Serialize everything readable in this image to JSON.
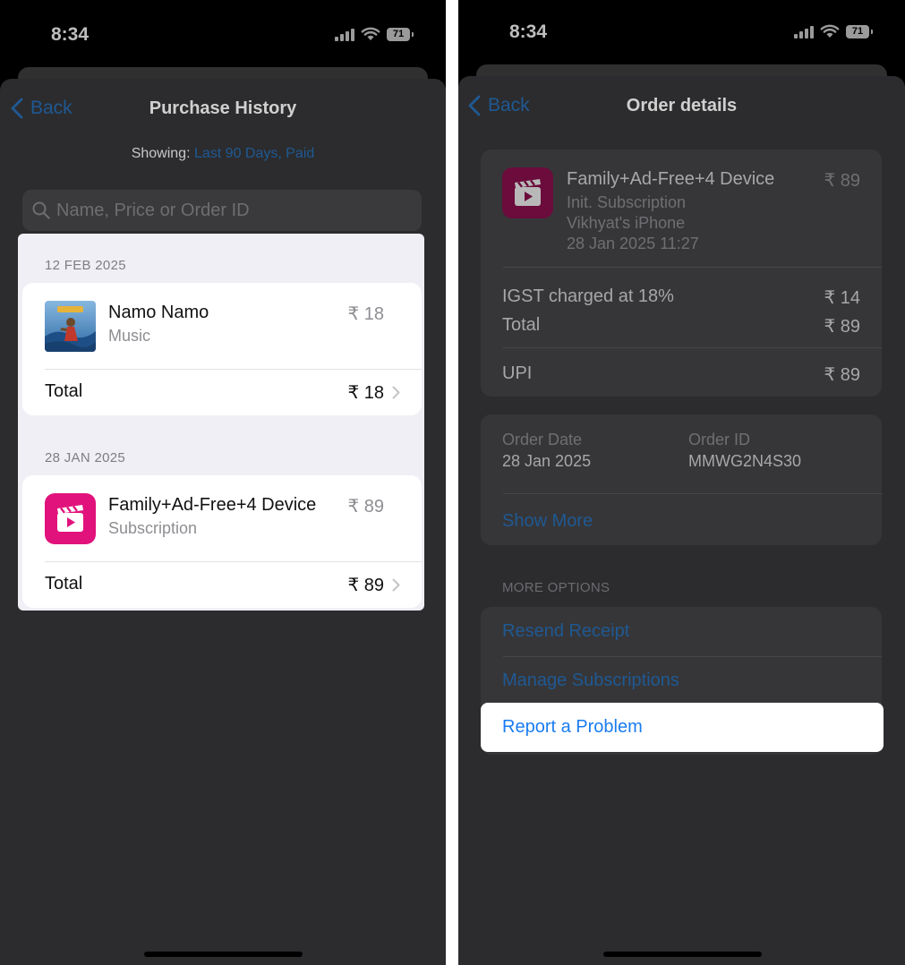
{
  "left_phone": {
    "status": {
      "time": "8:34",
      "battery": "71"
    },
    "nav": {
      "back_label": "Back",
      "title": "Purchase History"
    },
    "filter": {
      "label": "Showing:",
      "value": "Last 90 Days, Paid"
    },
    "search": {
      "placeholder": "Name, Price or Order ID"
    },
    "groups": [
      {
        "date": "12 FEB 2025",
        "item": {
          "title": "Namo Namo",
          "subtitle": "Music",
          "price": "₹ 18"
        },
        "total": {
          "label": "Total",
          "price": "₹ 18"
        }
      },
      {
        "date": "28 JAN 2025",
        "item": {
          "title": "Family+Ad-Free+4 Device",
          "subtitle": "Subscription",
          "price": "₹ 89"
        },
        "total": {
          "label": "Total",
          "price": "₹ 89"
        }
      }
    ]
  },
  "right_phone": {
    "status": {
      "time": "8:34",
      "battery": "71"
    },
    "nav": {
      "back_label": "Back",
      "title": "Order details"
    },
    "order_item": {
      "title": "Family+Ad-Free+4 Device",
      "price": "₹ 89",
      "lines": [
        "Init. Subscription",
        "Vikhyat's iPhone",
        "28 Jan 2025 11:27"
      ]
    },
    "charges": [
      {
        "label": "IGST charged at 18%",
        "value": "₹ 14"
      },
      {
        "label": "Total",
        "value": "₹ 89"
      }
    ],
    "payment": {
      "label": "UPI",
      "value": "₹ 89"
    },
    "order_info": {
      "date_label": "Order Date",
      "date_value": "28 Jan 2025",
      "id_label": "Order ID",
      "id_value": "MMWG2N4S30",
      "show_more": "Show More"
    },
    "more_options": {
      "header": "MORE OPTIONS",
      "resend_receipt": "Resend Receipt",
      "manage_subscriptions": "Manage Subscriptions",
      "report_problem": "Report a Problem"
    }
  },
  "colors": {
    "ios_blue": "#1a7cf0",
    "dimmed_blue": "#1f5993",
    "subscription_pink": "#e1127c",
    "sheet_dark": "#2c2c2e"
  },
  "icons": {
    "back": "chevron-left-icon",
    "search": "magnifying-glass-icon",
    "row_disclosure": "chevron-right-icon",
    "subscription_app": "clapperboard-play-icon"
  }
}
